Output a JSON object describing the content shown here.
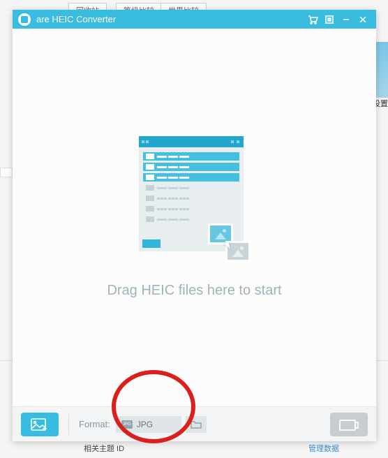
{
  "background": {
    "tab1": "回收站",
    "tab2": "等级比较",
    "tab3": "世界比较",
    "right_text": "设置",
    "bottom_label": "相关主题 ID",
    "bottom_link": "管理数据"
  },
  "titlebar": {
    "app_title": "are HEIC Converter"
  },
  "main": {
    "drop_text": "Drag HEIC files here to start"
  },
  "toolbar": {
    "format_label": "Format:",
    "format_value": "JPG",
    "format_badge": "JPG"
  }
}
